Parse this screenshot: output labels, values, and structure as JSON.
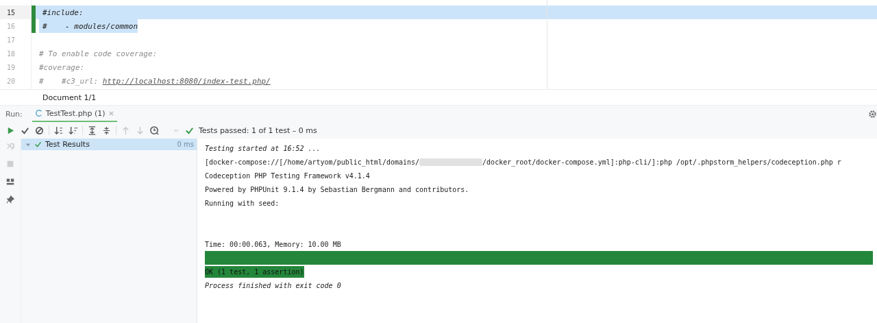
{
  "editor": {
    "lines": [
      {
        "number": "15",
        "current": true,
        "selected": true,
        "changed": true,
        "segments": [
          {
            "kind": "code",
            "text": "#include:"
          }
        ]
      },
      {
        "number": "16",
        "current": false,
        "selected": true,
        "changed": true,
        "segments": [
          {
            "kind": "code",
            "text": "#    - modules/common"
          }
        ]
      },
      {
        "number": "17",
        "current": false,
        "selected": false,
        "changed": false
      },
      {
        "number": "18",
        "current": false,
        "selected": false,
        "changed": false,
        "segments": [
          {
            "kind": "comment",
            "text": "# To enable code coverage:"
          }
        ]
      },
      {
        "number": "19",
        "current": false,
        "selected": false,
        "changed": false,
        "segments": [
          {
            "kind": "comment",
            "text": "#coverage:"
          }
        ]
      },
      {
        "number": "20",
        "current": false,
        "selected": false,
        "changed": false,
        "segments": [
          {
            "kind": "comment",
            "text": "#    #c3_url: "
          },
          {
            "kind": "link",
            "text": "http://localhost:8080/index-test.php/"
          }
        ]
      }
    ],
    "breadcrumb": "Document 1/1"
  },
  "run": {
    "label": "Run:",
    "tabs": [
      {
        "label": "TestTest.php (1)",
        "selected": true
      }
    ],
    "status": "Tests passed: 1 of 1 test – 0 ms",
    "tree": [
      {
        "label": "Test Results",
        "passed": true,
        "expanded": true,
        "selected": true,
        "time": "0 ms"
      }
    ],
    "console": [
      {
        "kind": "italic",
        "parts": [
          "Testing started at 16:52 ..."
        ]
      },
      {
        "kind": "redacted",
        "parts": [
          "[docker-compose://[/home/artyom/public_html/domains/",
          "/docker_root/docker-compose.yml]:php-cli/]:php /opt/.phpstorm_helpers/codeception.php r"
        ]
      },
      {
        "kind": "plain",
        "parts": [
          "Codeception PHP Testing Framework v4.1.4"
        ]
      },
      {
        "kind": "plain",
        "parts": [
          "Powered by PHPUnit 9.1.4 by Sebastian Bergmann and contributors."
        ]
      },
      {
        "kind": "plain",
        "parts": [
          "Running with seed:"
        ]
      },
      {
        "kind": "blank"
      },
      {
        "kind": "blank"
      },
      {
        "kind": "plain",
        "parts": [
          "Time: 00:00.063, Memory: 10.00 MB"
        ]
      },
      {
        "kind": "bar",
        "level": 1
      },
      {
        "kind": "ok",
        "parts": [
          "OK (1 test, 1 assertion)"
        ]
      },
      {
        "kind": "italic",
        "parts": [
          "Process finished with exit code 0"
        ]
      }
    ]
  }
}
